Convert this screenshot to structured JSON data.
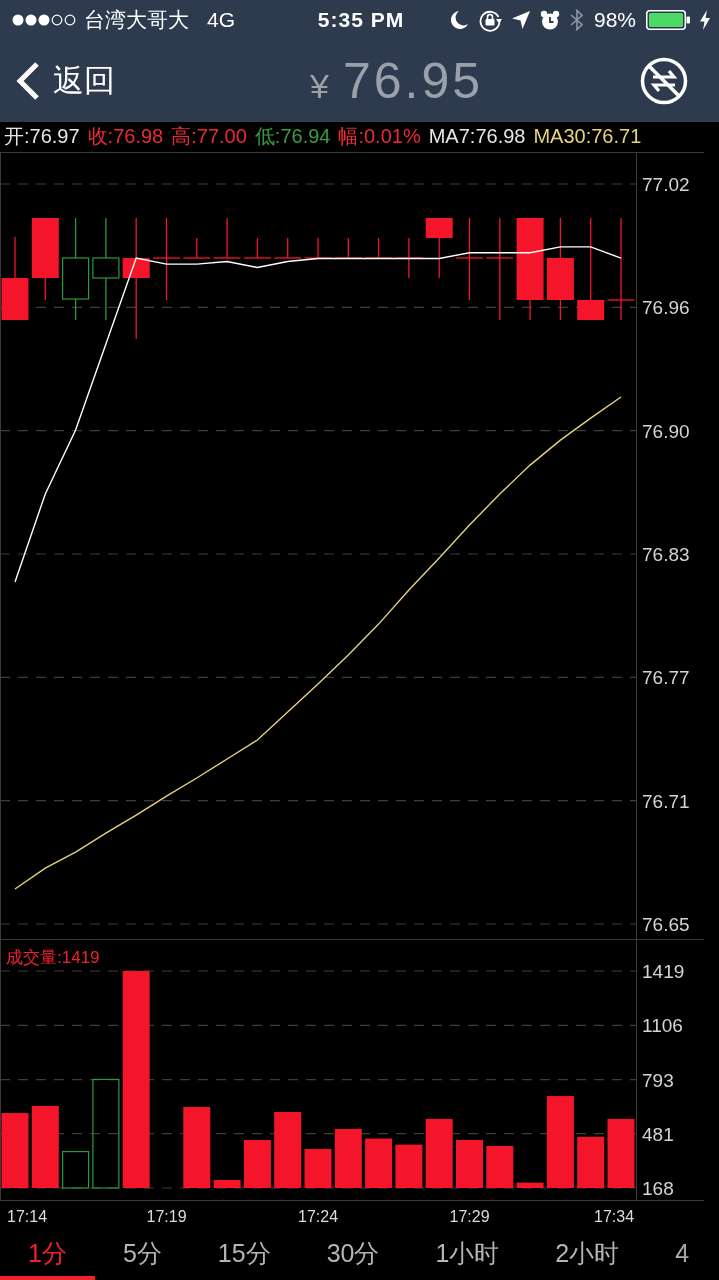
{
  "status_bar": {
    "carrier": "台湾大哥大",
    "network": "4G",
    "time": "5:35 PM",
    "battery": "98%"
  },
  "nav_bar": {
    "back_label": "返回",
    "currency": "¥",
    "price": "76.95"
  },
  "quote": [
    {
      "text": "开:76.97",
      "color": "#e6e6e6"
    },
    {
      "text": "收:76.98",
      "color": "#ea2a36"
    },
    {
      "text": "高:77.00",
      "color": "#ea2a36"
    },
    {
      "text": "低:76.94",
      "color": "#3a9c3e"
    },
    {
      "text": "幅:0.01%",
      "color": "#ea2a36"
    },
    {
      "text": "MA7:76.98",
      "color": "#e6e6e6"
    },
    {
      "text": "MA30:76.71",
      "color": "#e8d47a"
    }
  ],
  "price_chart": {
    "chart_data": {
      "type": "line",
      "ylim": [
        76.649,
        77.0186
      ],
      "yticks": [
        {
          "value": 77.0186,
          "label": "77.02"
        },
        {
          "value": 76.957,
          "label": "76.96"
        },
        {
          "value": 76.8954,
          "label": "76.90"
        },
        {
          "value": 76.8338,
          "label": "76.83"
        },
        {
          "value": 76.7722,
          "label": "76.77"
        },
        {
          "value": 76.7106,
          "label": "76.71"
        },
        {
          "value": 76.649,
          "label": "76.65"
        }
      ],
      "grid": true,
      "series": [
        {
          "color": "#ffffff",
          "values": [
            76.8198,
            76.8638,
            76.8957,
            76.9387,
            76.9816,
            76.9786,
            76.9786,
            76.9799,
            76.9769,
            76.9799,
            76.9814,
            76.9814,
            76.9814,
            76.9814,
            76.9814,
            76.9843,
            76.9843,
            76.9843,
            76.9872,
            76.9872,
            76.9816
          ]
        },
        {
          "color": "#e6d27c",
          "values": [
            76.6665,
            76.6769,
            76.6849,
            76.6944,
            76.7034,
            76.7129,
            76.7219,
            76.7314,
            76.7409,
            76.7549,
            76.7688,
            76.7833,
            76.7988,
            76.8158,
            76.8318,
            76.8483,
            76.8638,
            76.8782,
            76.8907,
            76.9017,
            76.9122
          ]
        }
      ]
    }
  },
  "volume_chart": {
    "chart_data": {
      "type": "bar",
      "title": "成交量:1419",
      "categories": [
        "17:14",
        null,
        null,
        null,
        null,
        "17:19",
        null,
        null,
        null,
        null,
        "17:24",
        null,
        null,
        null,
        null,
        "17:29",
        null,
        null,
        null,
        null,
        "17:34"
      ],
      "series": [
        {
          "color": "#f5152b",
          "values": [
            600,
            641,
            null,
            null,
            1419,
            null,
            635,
            214,
            445,
            606,
            393,
            508,
            453,
            418,
            566,
            445,
            410,
            199,
            698,
            463,
            566
          ]
        },
        {
          "color": "#2f9a3a",
          "values": [
            null,
            null,
            378,
            794,
            null,
            null,
            null,
            null,
            null,
            null,
            null,
            null,
            null,
            null,
            null,
            null,
            null,
            null,
            null,
            null,
            null
          ]
        }
      ],
      "ylim": [
        168,
        1419
      ],
      "yticks": [
        1419,
        1106,
        793,
        481,
        168
      ],
      "grid": true
    }
  },
  "periods": [
    {
      "label": "1分",
      "selected": true
    },
    {
      "label": "5分",
      "selected": false
    },
    {
      "label": "15分",
      "selected": false
    },
    {
      "label": "30分",
      "selected": false
    },
    {
      "label": "1小时",
      "selected": false
    },
    {
      "label": "2小时",
      "selected": false
    },
    {
      "label": "4",
      "selected": false
    }
  ]
}
